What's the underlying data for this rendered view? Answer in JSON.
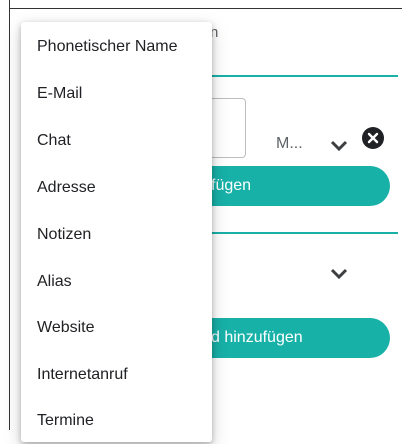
{
  "menu": {
    "items": [
      {
        "label": "Phonetischer Name"
      },
      {
        "label": "E-Mail"
      },
      {
        "label": "Chat"
      },
      {
        "label": "Adresse"
      },
      {
        "label": "Notizen"
      },
      {
        "label": "Alias"
      },
      {
        "label": "Website"
      },
      {
        "label": "Internetanruf"
      },
      {
        "label": "Termine"
      }
    ]
  },
  "background": {
    "partial_label_top": "n",
    "type_select_value": "M...",
    "add_button_1_partial": "fügen",
    "add_button_2_partial": "d hinzufügen"
  },
  "colors": {
    "accent": "#18b1a8",
    "menu_background": "#ffffff",
    "text": "#202124"
  },
  "icons": {
    "chevron": "chevron-down-icon",
    "clear": "close-icon"
  }
}
